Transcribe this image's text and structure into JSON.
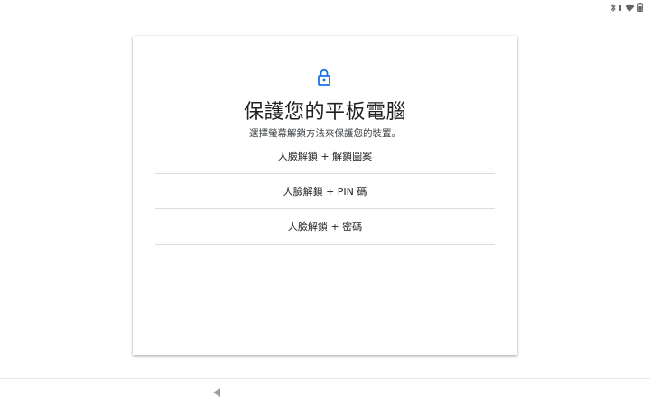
{
  "status_bar": {
    "icons": [
      "bluetooth-icon",
      "vibrate-icon",
      "wifi-icon",
      "battery-icon"
    ]
  },
  "card": {
    "icon": "lock-icon",
    "title": "保護您的平板電腦",
    "subtitle": "選擇螢幕解鎖方法來保護您的裝置。",
    "options": [
      {
        "label": "人臉解鎖 + 解鎖圖案"
      },
      {
        "label": "人臉解鎖 + PIN 碼"
      },
      {
        "label": "人臉解鎖 + 密碼"
      }
    ]
  },
  "navigation": {
    "back_icon": "back-triangle-icon"
  },
  "colors": {
    "accent": "#1a73e8",
    "title_text": "#202124",
    "divider": "#dadce0",
    "status_icons": "#5f6368",
    "nav_icon": "#9e9e9e"
  }
}
